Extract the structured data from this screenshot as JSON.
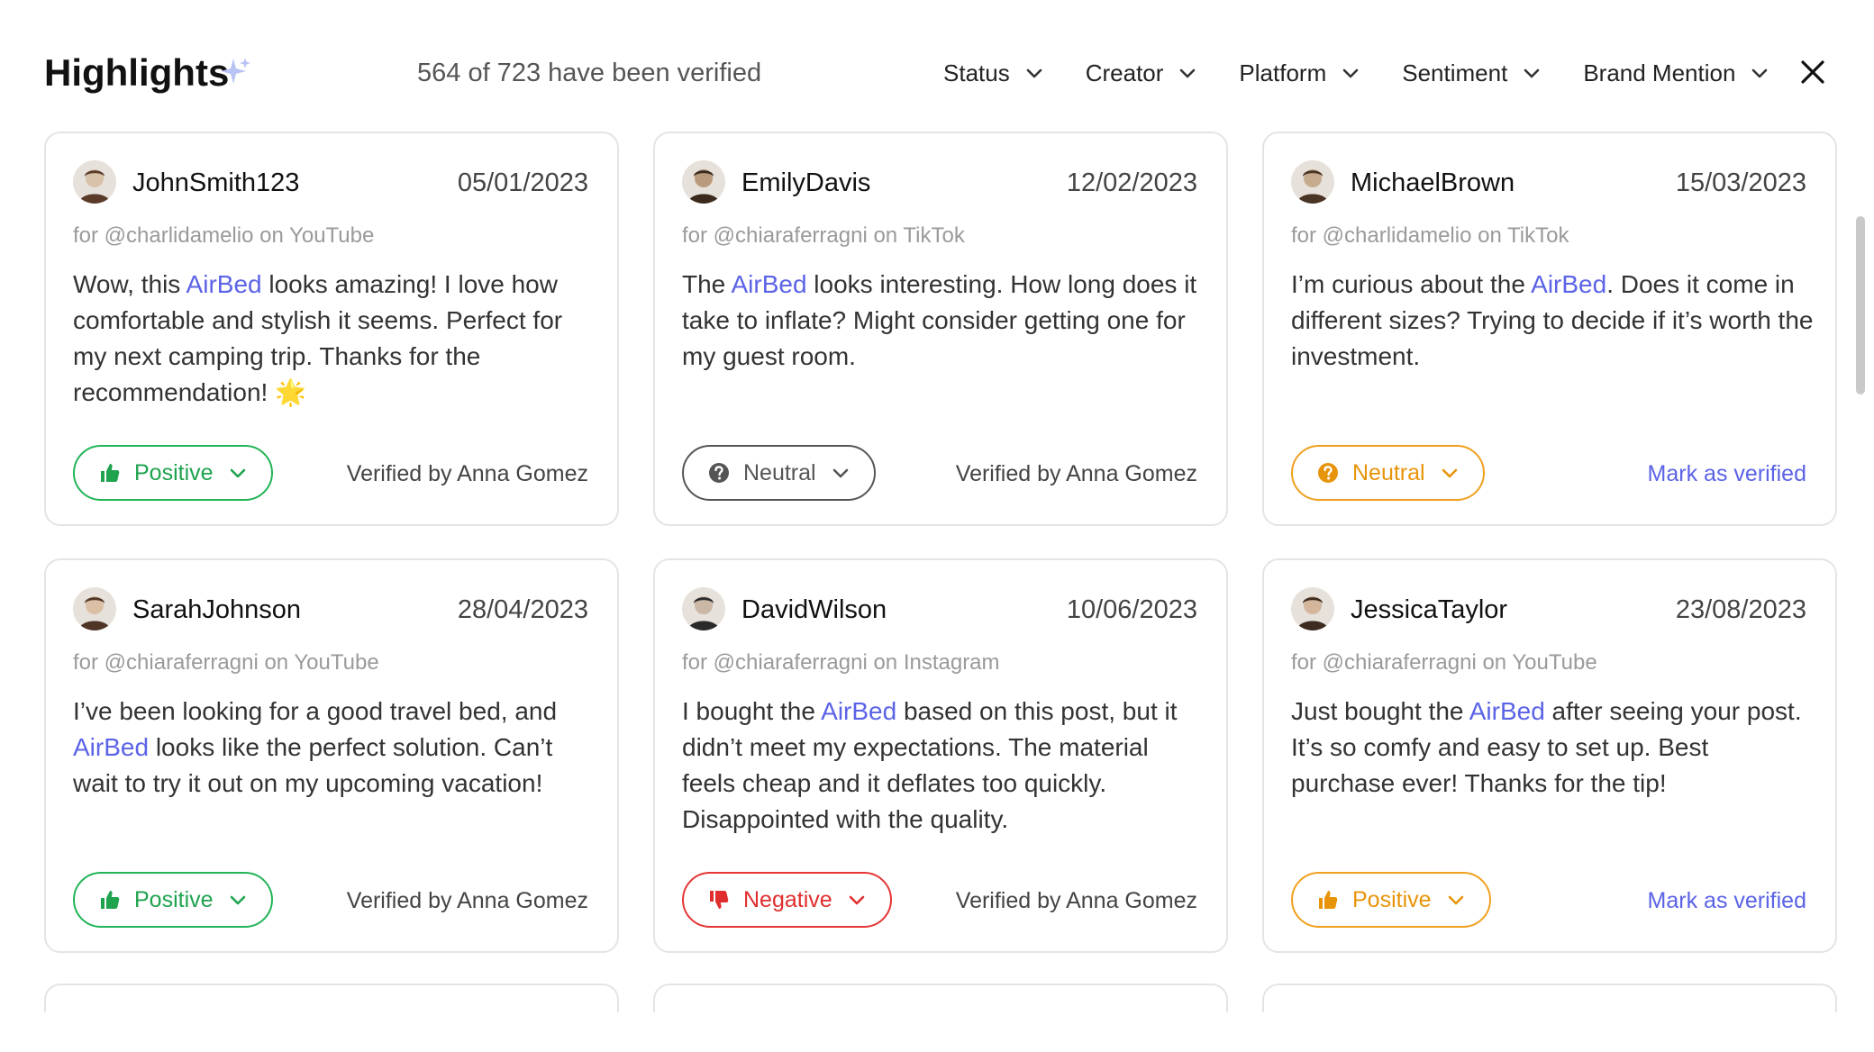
{
  "header": {
    "title": "Highlights",
    "verified_count": "564 of 723 have been verified",
    "filters": [
      "Status",
      "Creator",
      "Platform",
      "Sentiment",
      "Brand Mention"
    ]
  },
  "colors": {
    "brand": "#5b63e6",
    "positive": "#22b457",
    "neutral": "#555555",
    "warning": "#f0a01e",
    "negative": "#e53535"
  },
  "cards": [
    {
      "username": "JohnSmith123",
      "date": "05/01/2023",
      "source": "for @charlidamelio on YouTube",
      "comment_before": "Wow, this ",
      "brand": "AirBed",
      "comment_after": " looks amazing! I love how comfortable and stylish it seems. Perfect for my next camping trip. Thanks for the recommendation! 🌟",
      "sentiment": "Positive",
      "sentiment_icon": "thumbs-up-icon",
      "action": "Verified by Anna Gomez"
    },
    {
      "username": "EmilyDavis",
      "date": "12/02/2023",
      "source": "for @chiaraferragni on TikTok",
      "comment_before": "The ",
      "brand": "AirBed",
      "comment_after": " looks interesting. How long does it take to inflate? Might consider getting one for my guest room.",
      "sentiment": "Neutral",
      "sentiment_icon": "question-circle-icon",
      "action": "Verified by Anna Gomez"
    },
    {
      "username": "MichaelBrown",
      "date": "15/03/2023",
      "source": "for @charlidamelio on TikTok",
      "comment_before": "I’m curious about the ",
      "brand": "AirBed",
      "comment_after": ". Does it come in different sizes? Trying to decide if it’s worth the investment.",
      "sentiment": "Neutral",
      "sentiment_icon": "question-circle-icon",
      "action": "Mark as verified"
    },
    {
      "username": "SarahJohnson",
      "date": "28/04/2023",
      "source": "for @chiaraferragni on YouTube",
      "comment_before": "I’ve been looking for a good travel bed, and ",
      "brand": "AirBed",
      "comment_after": " looks like the perfect solution. Can’t wait to try it out on my upcoming vacation!",
      "sentiment": "Positive",
      "sentiment_icon": "thumbs-up-icon",
      "action": "Verified by Anna Gomez"
    },
    {
      "username": "DavidWilson",
      "date": "10/06/2023",
      "source": "for @chiaraferragni on Instagram",
      "comment_before": "I bought the ",
      "brand": "AirBed",
      "comment_after": " based on this post, but it didn’t meet my expectations. The material feels cheap and it deflates too quickly. Disappointed with the quality.",
      "sentiment": "Negative",
      "sentiment_icon": "thumbs-down-icon",
      "action": "Verified by Anna Gomez"
    },
    {
      "username": "JessicaTaylor",
      "date": "23/08/2023",
      "source": "for @chiaraferragni on YouTube",
      "comment_before": "Just bought the ",
      "brand": "AirBed",
      "comment_after": " after seeing your post. It’s so comfy and easy to set up. Best purchase ever! Thanks for the tip!",
      "sentiment": "Positive",
      "sentiment_icon": "thumbs-up-icon",
      "action": "Mark as verified"
    }
  ]
}
